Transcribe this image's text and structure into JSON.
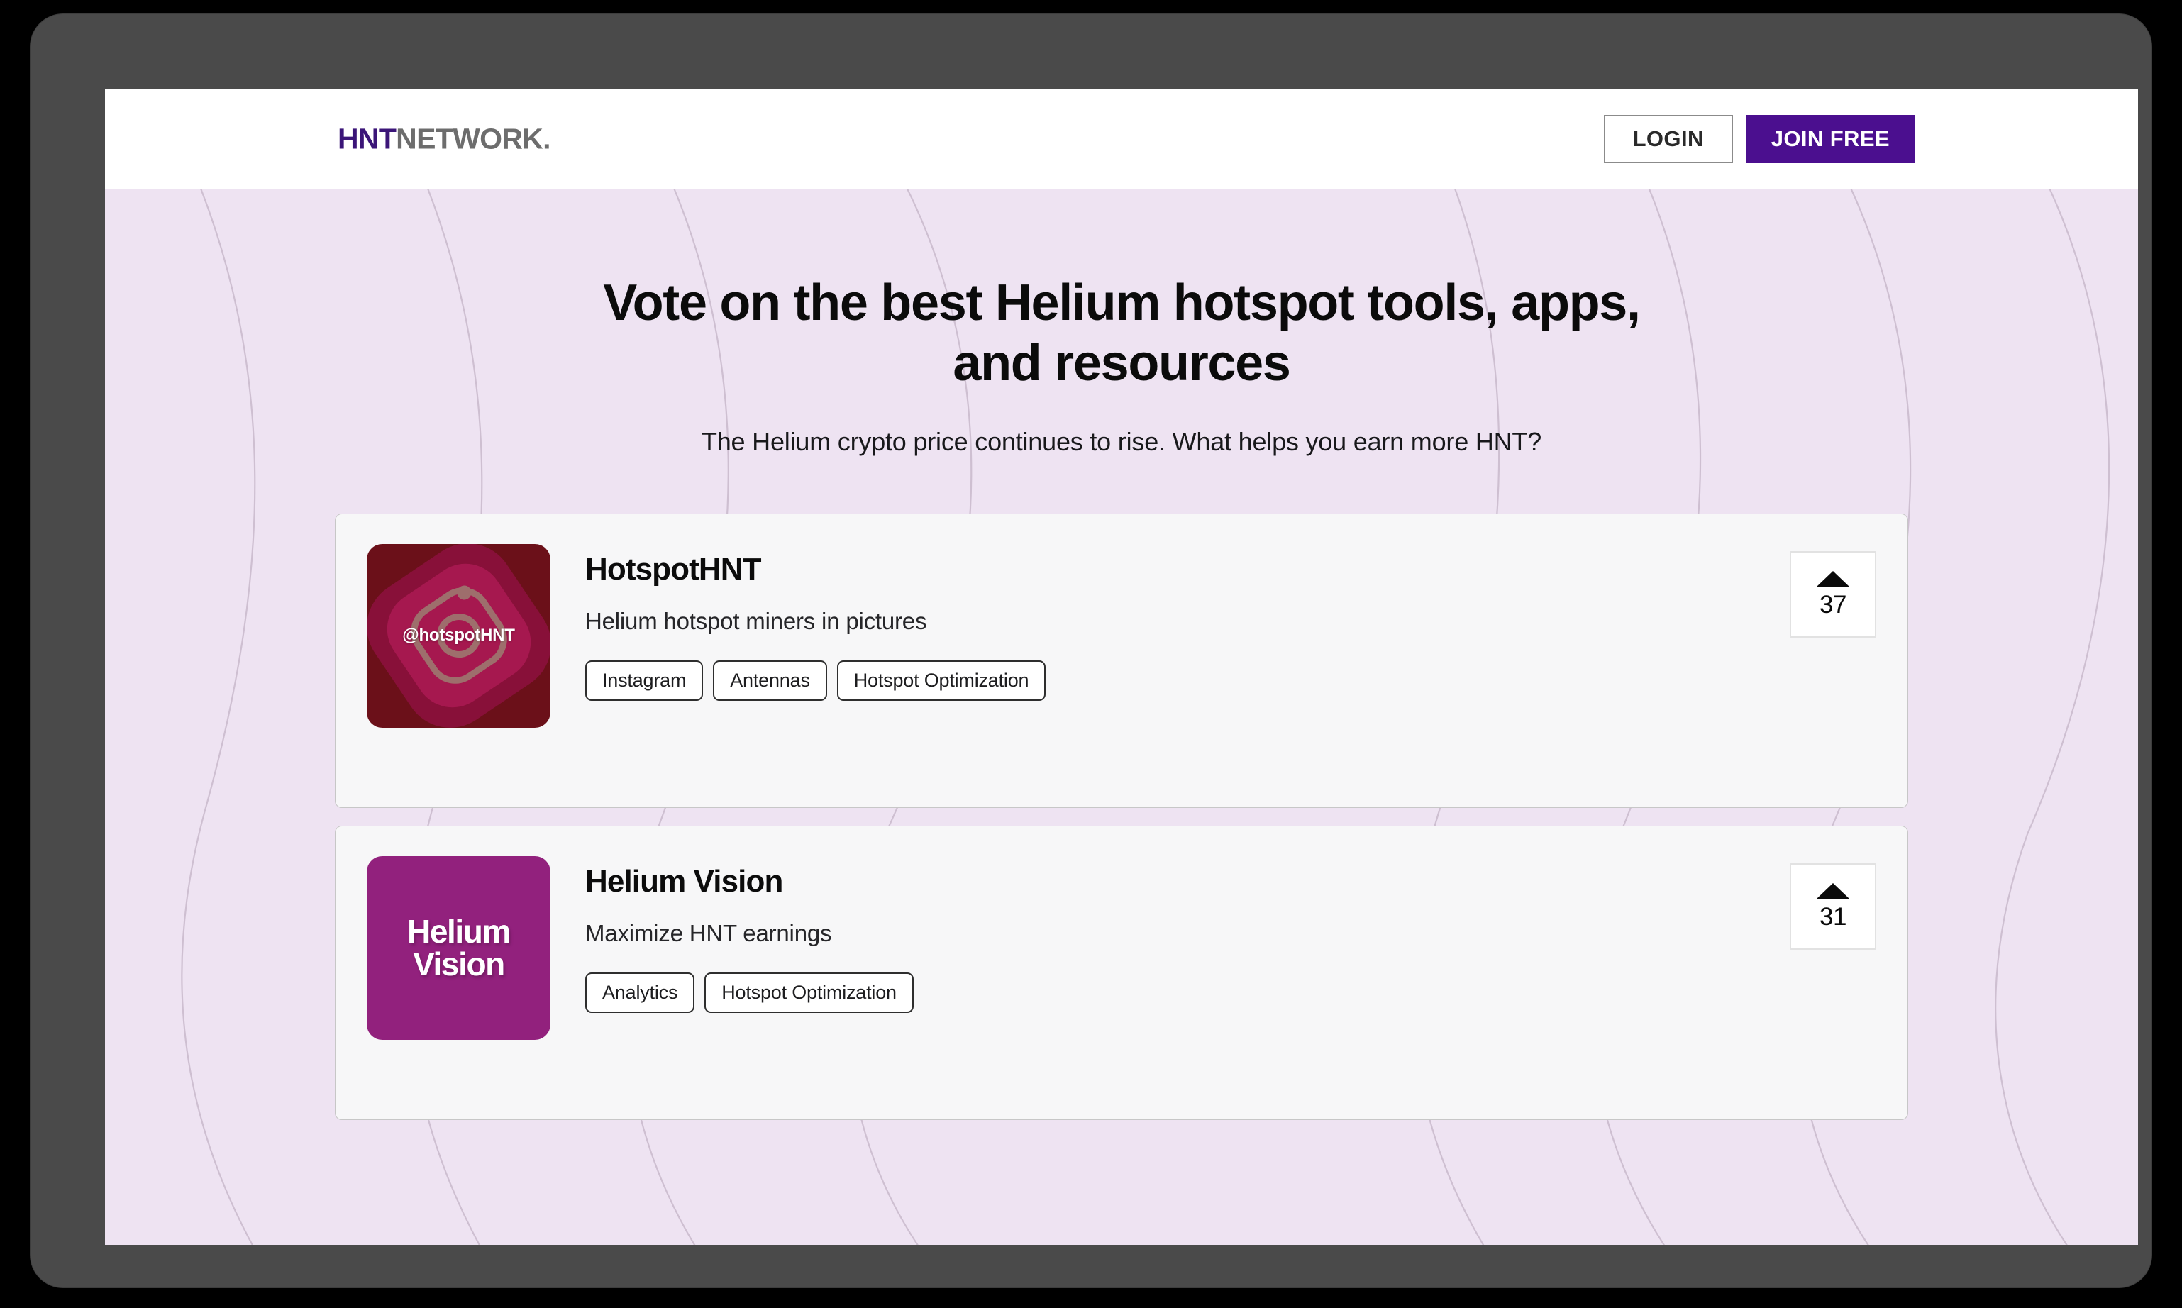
{
  "header": {
    "logo": {
      "primary": "HNT",
      "secondary": "NETWORK."
    },
    "login_label": "LOGIN",
    "join_label": "JOIN FREE"
  },
  "hero": {
    "title": "Vote on the best Helium hotspot tools, apps, and resources",
    "subtitle": "The Helium crypto price continues to rise. What helps you earn more HNT?"
  },
  "colors": {
    "brand_purple": "#3b1578",
    "cta_purple": "#4b0f8f",
    "hero_background": "#eee3f2",
    "card_background": "#f7f7f8",
    "bezel": "#4a4a4a",
    "thumb_hotspothnt": "#6b1019",
    "thumb_hotspothnt_accent": "#a6184f",
    "thumb_heliumvision": "#92217d"
  },
  "products": [
    {
      "name": "HotspotHNT",
      "tagline": "Helium hotspot miners in pictures",
      "thumb_label": "@hotspotHNT",
      "thumb_kind": "instagram-logo",
      "tags": [
        "Instagram",
        "Antennas",
        "Hotspot Optimization"
      ],
      "votes": "37"
    },
    {
      "name": "Helium Vision",
      "tagline": "Maximize HNT earnings",
      "thumb_label_line1": "Helium",
      "thumb_label_line2": "Vision",
      "thumb_kind": "wordmark",
      "tags": [
        "Analytics",
        "Hotspot Optimization"
      ],
      "votes": "31"
    }
  ]
}
